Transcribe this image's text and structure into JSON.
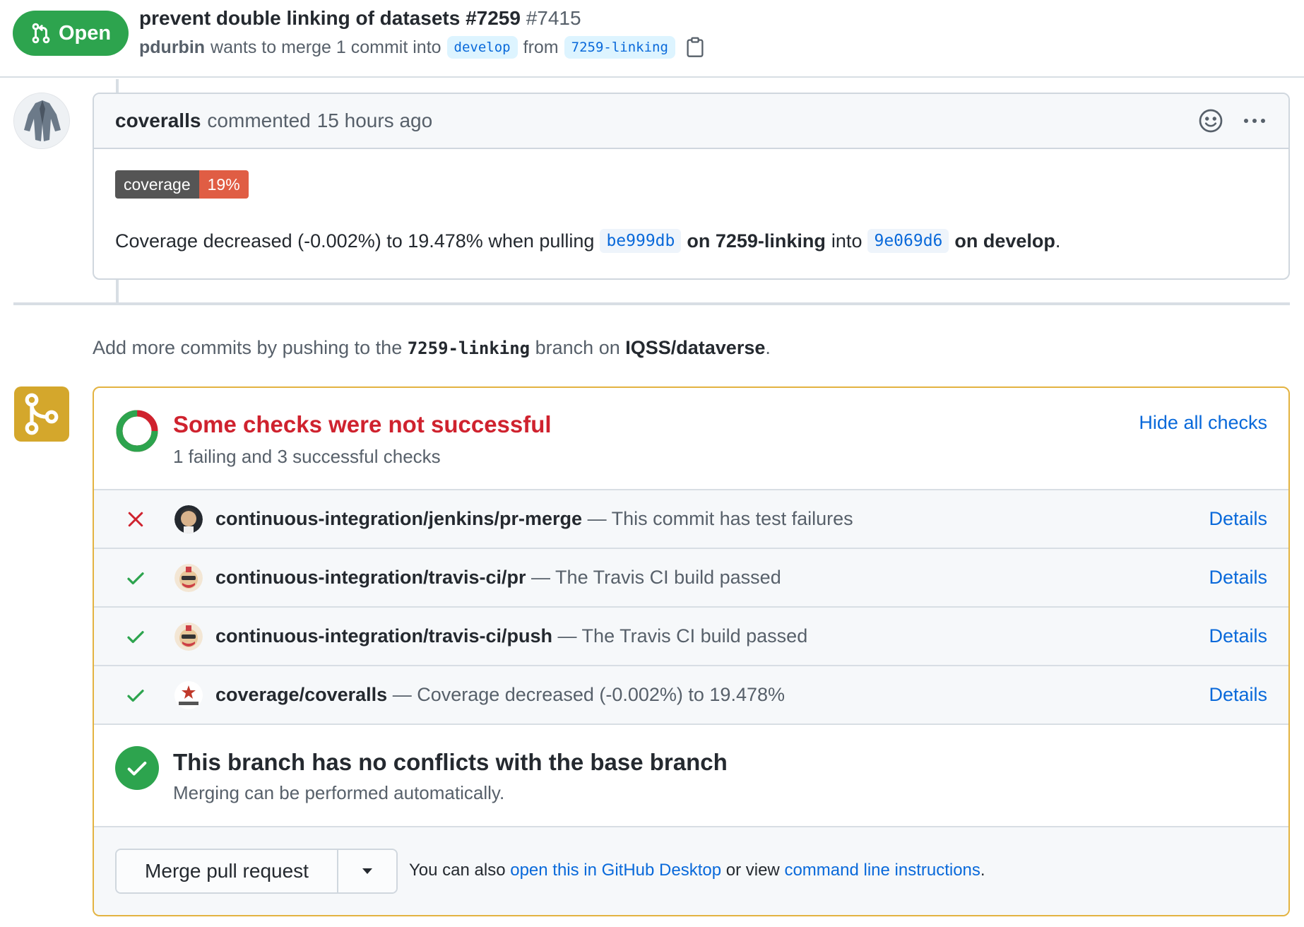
{
  "header": {
    "state": "Open",
    "title": "prevent double linking of datasets #7259",
    "number": "#7415",
    "author": "pdurbin",
    "merge_text": "wants to merge 1 commit into",
    "base_branch": "develop",
    "from_text": "from",
    "head_branch": "7259-linking"
  },
  "comment": {
    "author": "coveralls",
    "action": "commented",
    "time": "15 hours ago",
    "badge_label": "coverage",
    "badge_value": "19%",
    "text_prefix": "Coverage decreased (-0.002%) to 19.478% when pulling",
    "head_sha": "be999db",
    "on_head": "on 7259-linking",
    "into_text": "into",
    "base_sha": "9e069d6",
    "on_base": "on develop",
    "period": "."
  },
  "push_note": {
    "prefix": "Add more commits by pushing to the",
    "branch": "7259-linking",
    "middle": "branch on",
    "repo": "IQSS/dataverse",
    "period": "."
  },
  "checks": {
    "title": "Some checks were not successful",
    "subtitle": "1 failing and 3 successful checks",
    "hide_label": "Hide all checks",
    "passed_fraction": 0.75,
    "items": [
      {
        "status": "failure",
        "name": "continuous-integration/jenkins/pr-merge",
        "desc": "— This commit has test failures",
        "details": "Details"
      },
      {
        "status": "success",
        "name": "continuous-integration/travis-ci/pr",
        "desc": "— The Travis CI build passed",
        "details": "Details"
      },
      {
        "status": "success",
        "name": "continuous-integration/travis-ci/push",
        "desc": "— The Travis CI build passed",
        "details": "Details"
      },
      {
        "status": "success",
        "name": "coverage/coveralls",
        "desc": "— Coverage decreased (-0.002%) to 19.478%",
        "details": "Details"
      }
    ]
  },
  "conflicts": {
    "title": "This branch has no conflicts with the base branch",
    "subtitle": "Merging can be performed automatically."
  },
  "merge": {
    "button_label": "Merge pull request",
    "also_prefix": "You can also",
    "desktop_link": "open this in GitHub Desktop",
    "or_view": "or view",
    "cli_link": "command line instructions",
    "period": "."
  },
  "colors": {
    "open_green": "#2da44e",
    "failure_red": "#cf222e",
    "link_blue": "#0969da",
    "pending_yellow": "#d4a72c"
  }
}
